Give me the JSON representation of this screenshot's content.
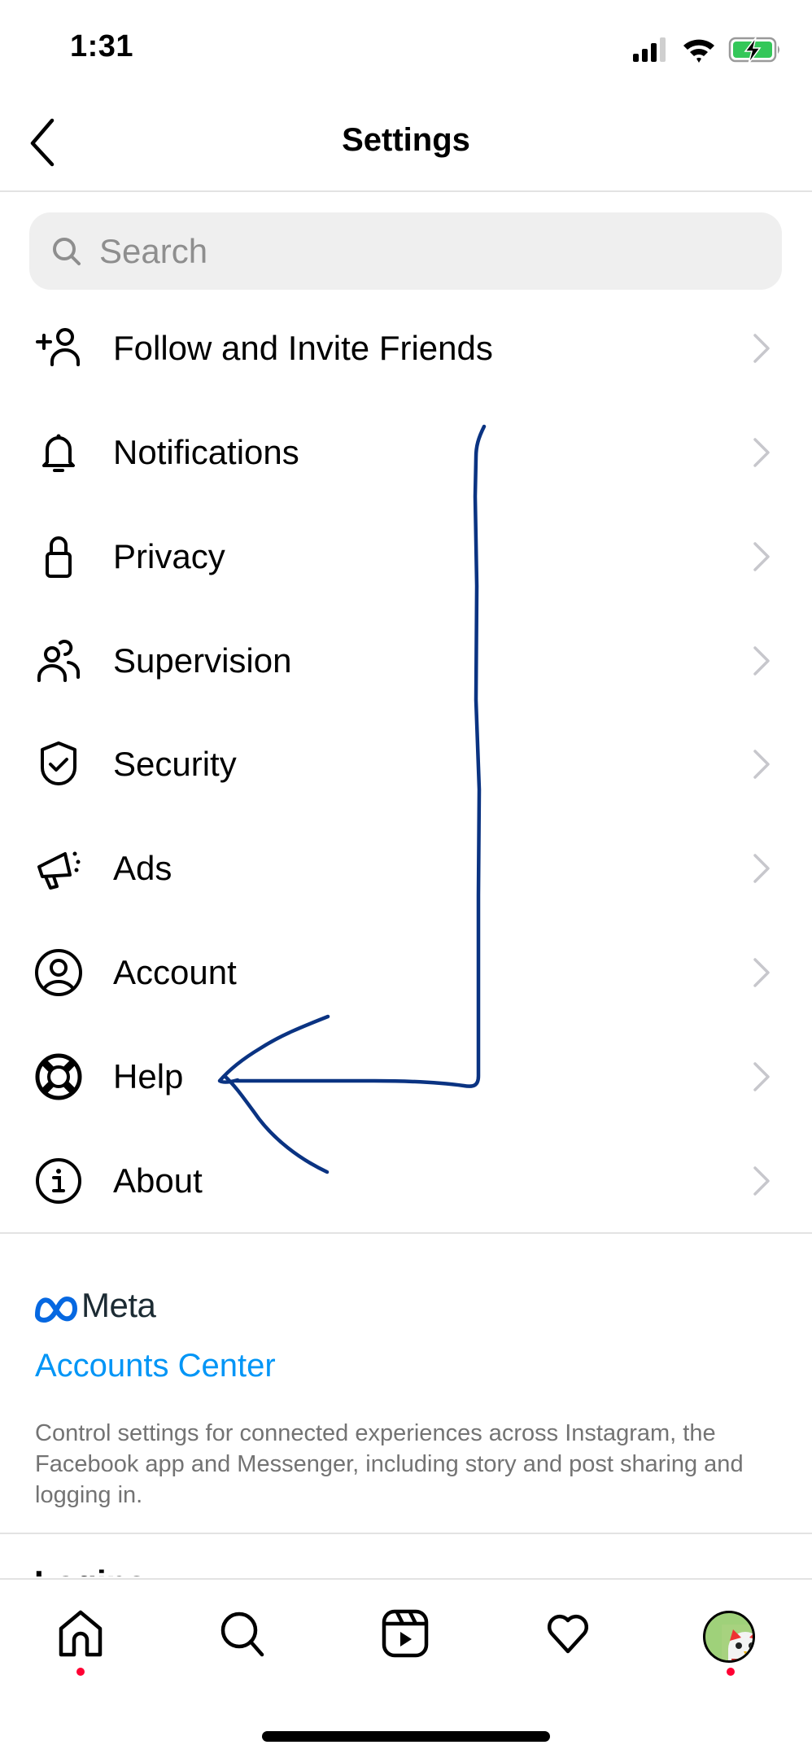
{
  "status_bar": {
    "time": "1:31",
    "signal_icon": "cellular-signal-icon",
    "wifi_icon": "wifi-icon",
    "battery_icon": "battery-charging-icon",
    "battery_color": "#34c759"
  },
  "header": {
    "title": "Settings",
    "back_icon": "chevron-left-icon"
  },
  "search": {
    "placeholder": "Search",
    "value": "",
    "icon": "search-icon"
  },
  "menu": {
    "items": [
      {
        "label": "Follow and Invite Friends",
        "icon": "add-person-icon"
      },
      {
        "label": "Notifications",
        "icon": "bell-icon"
      },
      {
        "label": "Privacy",
        "icon": "lock-icon"
      },
      {
        "label": "Supervision",
        "icon": "people-icon"
      },
      {
        "label": "Security",
        "icon": "shield-check-icon"
      },
      {
        "label": "Ads",
        "icon": "megaphone-icon"
      },
      {
        "label": "Account",
        "icon": "user-circle-icon"
      },
      {
        "label": "Help",
        "icon": "lifebuoy-icon"
      },
      {
        "label": "About",
        "icon": "info-icon"
      }
    ],
    "chevron_icon": "chevron-right-icon"
  },
  "meta_section": {
    "logo_text": "Meta",
    "logo_color": "#0668e1",
    "accounts_center_label": "Accounts Center",
    "link_color": "#0095f6",
    "description": "Control settings for connected experiences across Instagram, the Facebook app and Messenger, including story and post sharing and logging in."
  },
  "next_section": {
    "heading": "Logins"
  },
  "bottom_nav": {
    "tabs": [
      {
        "name": "home",
        "icon": "home-icon",
        "has_badge": true
      },
      {
        "name": "search",
        "icon": "search-icon",
        "has_badge": false
      },
      {
        "name": "reels",
        "icon": "reels-icon",
        "has_badge": false
      },
      {
        "name": "activity",
        "icon": "heart-icon",
        "has_badge": false
      },
      {
        "name": "profile",
        "icon": "avatar",
        "has_badge": true
      }
    ],
    "badge_color": "#ff0033"
  },
  "annotation": {
    "type": "hand-drawn arrow pointing to Help",
    "color": "#0a3382"
  }
}
